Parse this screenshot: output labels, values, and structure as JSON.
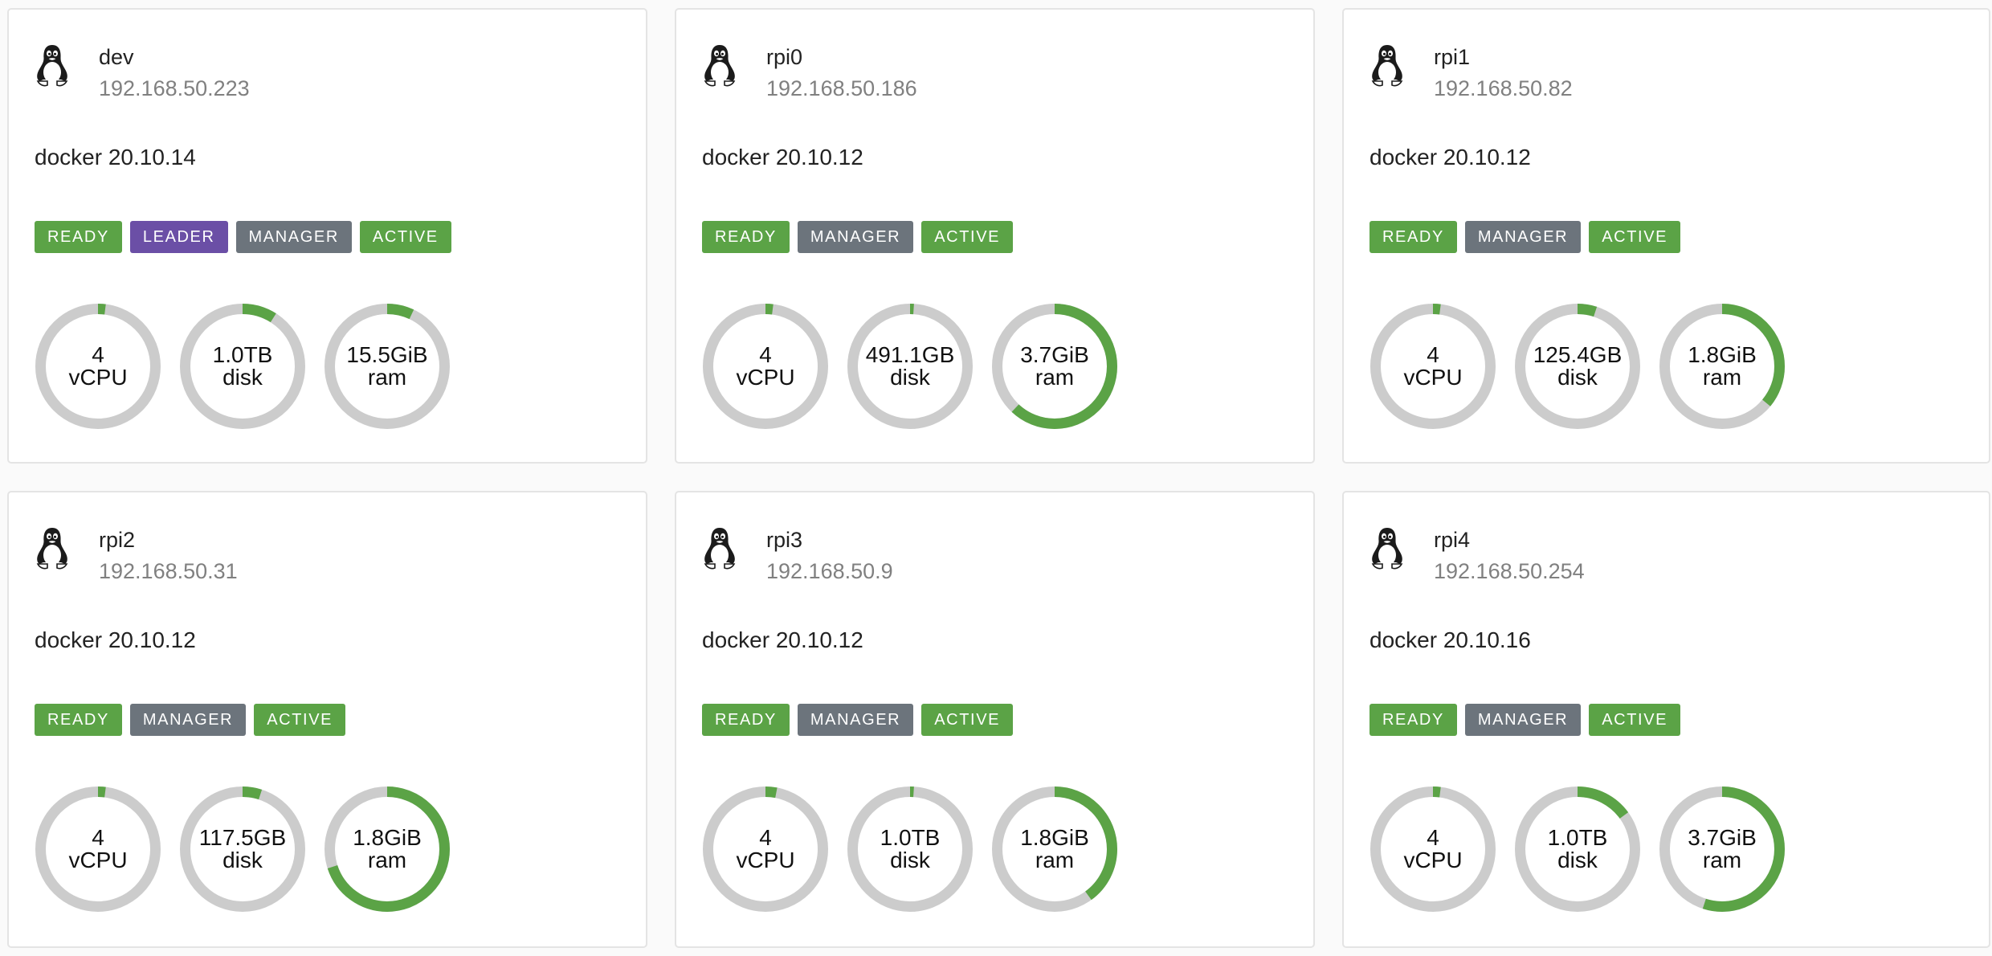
{
  "colors": {
    "ready": "#5ba346",
    "leader": "#6b4fa6",
    "manager": "#6c747c",
    "active": "#5ba346",
    "gauge_track": "#cccccc",
    "gauge_fill": "#5ba346"
  },
  "nodes": [
    {
      "os_icon": "linux-tux-icon",
      "name": "dev",
      "ip": "192.168.50.223",
      "docker": "docker 20.10.14",
      "badges": [
        {
          "label": "READY",
          "kind": "ready"
        },
        {
          "label": "LEADER",
          "kind": "leader"
        },
        {
          "label": "MANAGER",
          "kind": "manager"
        },
        {
          "label": "ACTIVE",
          "kind": "active"
        }
      ],
      "resources": [
        {
          "value": "4",
          "unit": "vCPU",
          "usage": 0.02
        },
        {
          "value": "1.0TB",
          "unit": "disk",
          "usage": 0.09
        },
        {
          "value": "15.5GiB",
          "unit": "ram",
          "usage": 0.07
        }
      ]
    },
    {
      "os_icon": "linux-tux-icon",
      "name": "rpi0",
      "ip": "192.168.50.186",
      "docker": "docker 20.10.12",
      "badges": [
        {
          "label": "READY",
          "kind": "ready"
        },
        {
          "label": "MANAGER",
          "kind": "manager"
        },
        {
          "label": "ACTIVE",
          "kind": "active"
        }
      ],
      "resources": [
        {
          "value": "4",
          "unit": "vCPU",
          "usage": 0.02
        },
        {
          "value": "491.1GB",
          "unit": "disk",
          "usage": 0.01
        },
        {
          "value": "3.7GiB",
          "unit": "ram",
          "usage": 0.62
        }
      ]
    },
    {
      "os_icon": "linux-tux-icon",
      "name": "rpi1",
      "ip": "192.168.50.82",
      "docker": "docker 20.10.12",
      "badges": [
        {
          "label": "READY",
          "kind": "ready"
        },
        {
          "label": "MANAGER",
          "kind": "manager"
        },
        {
          "label": "ACTIVE",
          "kind": "active"
        }
      ],
      "resources": [
        {
          "value": "4",
          "unit": "vCPU",
          "usage": 0.02
        },
        {
          "value": "125.4GB",
          "unit": "disk",
          "usage": 0.05
        },
        {
          "value": "1.8GiB",
          "unit": "ram",
          "usage": 0.36
        }
      ]
    },
    {
      "os_icon": "linux-tux-icon",
      "name": "rpi2",
      "ip": "192.168.50.31",
      "docker": "docker 20.10.12",
      "badges": [
        {
          "label": "READY",
          "kind": "ready"
        },
        {
          "label": "MANAGER",
          "kind": "manager"
        },
        {
          "label": "ACTIVE",
          "kind": "active"
        }
      ],
      "resources": [
        {
          "value": "4",
          "unit": "vCPU",
          "usage": 0.02
        },
        {
          "value": "117.5GB",
          "unit": "disk",
          "usage": 0.05
        },
        {
          "value": "1.8GiB",
          "unit": "ram",
          "usage": 0.7
        }
      ]
    },
    {
      "os_icon": "linux-tux-icon",
      "name": "rpi3",
      "ip": "192.168.50.9",
      "docker": "docker 20.10.12",
      "badges": [
        {
          "label": "READY",
          "kind": "ready"
        },
        {
          "label": "MANAGER",
          "kind": "manager"
        },
        {
          "label": "ACTIVE",
          "kind": "active"
        }
      ],
      "resources": [
        {
          "value": "4",
          "unit": "vCPU",
          "usage": 0.03
        },
        {
          "value": "1.0TB",
          "unit": "disk",
          "usage": 0.01
        },
        {
          "value": "1.8GiB",
          "unit": "ram",
          "usage": 0.4
        }
      ]
    },
    {
      "os_icon": "linux-tux-icon",
      "name": "rpi4",
      "ip": "192.168.50.254",
      "docker": "docker 20.10.16",
      "badges": [
        {
          "label": "READY",
          "kind": "ready"
        },
        {
          "label": "MANAGER",
          "kind": "manager"
        },
        {
          "label": "ACTIVE",
          "kind": "active"
        }
      ],
      "resources": [
        {
          "value": "4",
          "unit": "vCPU",
          "usage": 0.02
        },
        {
          "value": "1.0TB",
          "unit": "disk",
          "usage": 0.15
        },
        {
          "value": "3.7GiB",
          "unit": "ram",
          "usage": 0.55
        }
      ]
    }
  ]
}
